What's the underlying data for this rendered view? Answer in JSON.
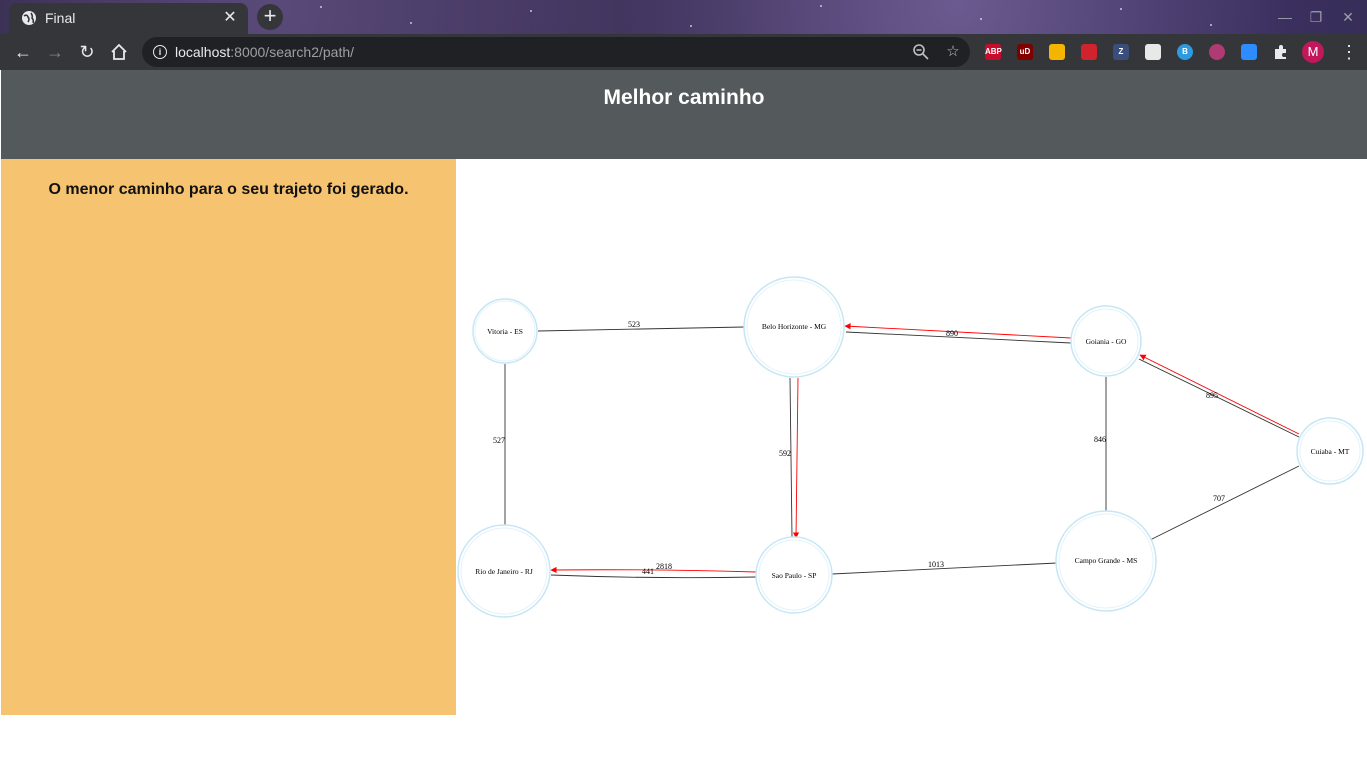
{
  "browser": {
    "tab_title": "Final",
    "url_host": "localhost",
    "url_rest": ":8000/search2/path/",
    "extensions": [
      {
        "name": "abp",
        "label": "ABP",
        "color": "#c70d2c"
      },
      {
        "name": "ublock",
        "label": "uD",
        "color": "#800000"
      },
      {
        "name": "colorful",
        "label": "",
        "color": "#f4b400"
      },
      {
        "name": "mendeley",
        "label": "",
        "color": "#d0232b"
      },
      {
        "name": "zotero",
        "label": "Z",
        "color": "#3b4e7b"
      },
      {
        "name": "pdf",
        "label": "",
        "color": "#e8e8e8"
      },
      {
        "name": "b",
        "label": "B",
        "color": "#2f9ae0"
      },
      {
        "name": "download",
        "label": "",
        "color": "#b03a72"
      },
      {
        "name": "zoom",
        "label": "",
        "color": "#2d8cff"
      }
    ],
    "avatar_letter": "M"
  },
  "header": {
    "title": "Melhor caminho"
  },
  "sidebar": {
    "message": "O menor caminho para o seu trajeto foi gerado."
  },
  "graph": {
    "nodes": [
      {
        "id": "vitoria",
        "label": "Vitoria - ES"
      },
      {
        "id": "bh",
        "label": "Belo Horizonte - MG"
      },
      {
        "id": "goiania",
        "label": "Goiania - GO"
      },
      {
        "id": "cuiaba",
        "label": "Cuiaba - MT"
      },
      {
        "id": "rio",
        "label": "Rio de Janeiro - RJ"
      },
      {
        "id": "sp",
        "label": "Sao Paulo - SP"
      },
      {
        "id": "cg",
        "label": "Campo Grande - MS"
      }
    ],
    "edges": [
      {
        "from": "vitoria",
        "to": "bh",
        "weight": "523"
      },
      {
        "from": "bh",
        "to": "goiania",
        "weight": "890"
      },
      {
        "from": "goiania",
        "to": "cuiaba",
        "weight": "895"
      },
      {
        "from": "vitoria",
        "to": "rio",
        "weight": "527"
      },
      {
        "from": "bh",
        "to": "sp",
        "weight": "592"
      },
      {
        "from": "goiania",
        "to": "cg",
        "weight": "846"
      },
      {
        "from": "cuiaba",
        "to": "cg",
        "weight": "707"
      },
      {
        "from": "sp",
        "to": "cg",
        "weight": "1013"
      },
      {
        "from": "rio",
        "to": "sp",
        "weight": "441"
      },
      {
        "from": "sp",
        "to": "rio",
        "weight": "2818"
      }
    ],
    "highlighted_path": [
      "cuiaba",
      "goiania",
      "bh",
      "sp",
      "rio"
    ],
    "path_color": "#ff0000",
    "edge_color": "#333333",
    "node_border_color": "#c6e6f5"
  }
}
